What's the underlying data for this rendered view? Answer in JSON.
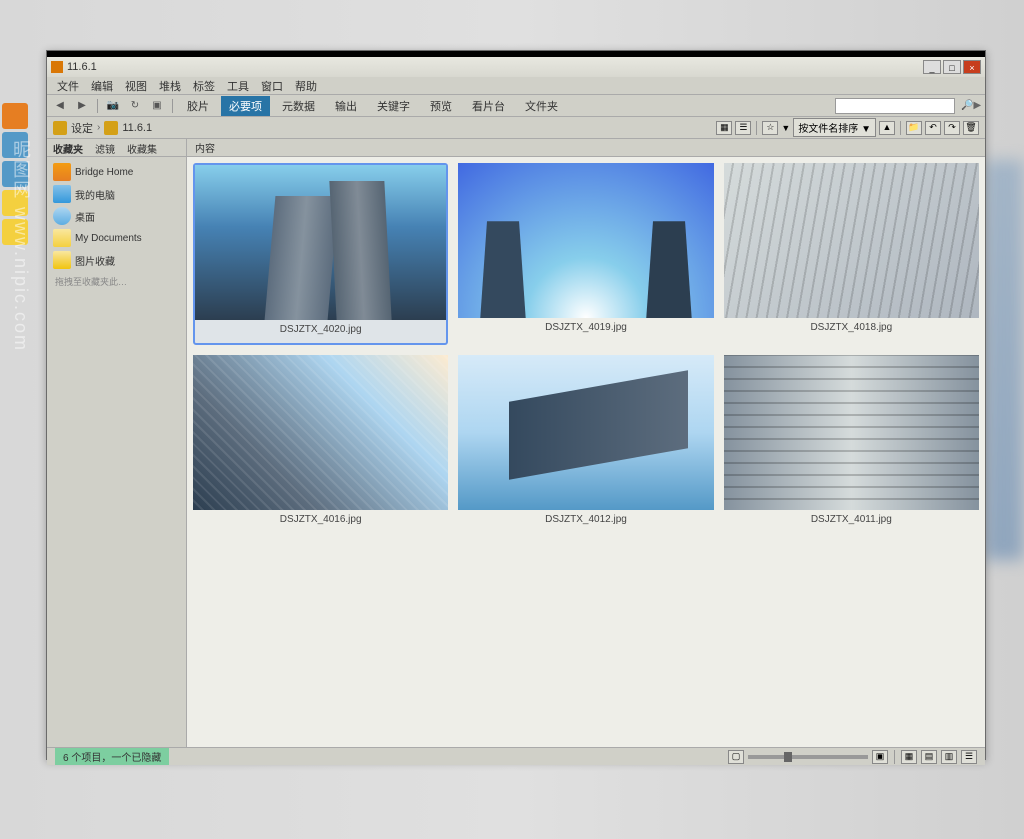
{
  "window": {
    "title": "11.6.1"
  },
  "menubar": [
    "文件",
    "编辑",
    "视图",
    "堆栈",
    "标签",
    "工具",
    "窗口",
    "帮助"
  ],
  "tabs": [
    "胶片",
    "必要项",
    "元数据",
    "输出",
    "关键字",
    "预览",
    "看片台",
    "文件夹"
  ],
  "active_tab_index": 1,
  "breadcrumb": {
    "root": "设定",
    "current": "11.6.1"
  },
  "sort": {
    "label": "按文件名排序",
    "arrow": "▼"
  },
  "sidebar": {
    "tabs": [
      "收藏夹",
      "滤镜",
      "收藏集"
    ],
    "items": [
      {
        "label": "Bridge Home"
      },
      {
        "label": "我的电脑"
      },
      {
        "label": "桌面"
      },
      {
        "label": "My Documents"
      },
      {
        "label": "图片收藏"
      }
    ],
    "hint": "拖拽至收藏夹此…"
  },
  "content": {
    "header": "内容",
    "thumbnails": [
      {
        "filename": "DSJZTX_4020.jpg",
        "selected": true
      },
      {
        "filename": "DSJZTX_4019.jpg",
        "selected": false
      },
      {
        "filename": "DSJZTX_4018.jpg",
        "selected": false
      },
      {
        "filename": "DSJZTX_4016.jpg",
        "selected": false
      },
      {
        "filename": "DSJZTX_4012.jpg",
        "selected": false
      },
      {
        "filename": "DSJZTX_4011.jpg",
        "selected": false
      }
    ]
  },
  "statusbar": {
    "text": "6 个项目，一个已隐藏"
  },
  "search": {
    "placeholder": ""
  },
  "watermark": "昵图网 www.nipic.com"
}
